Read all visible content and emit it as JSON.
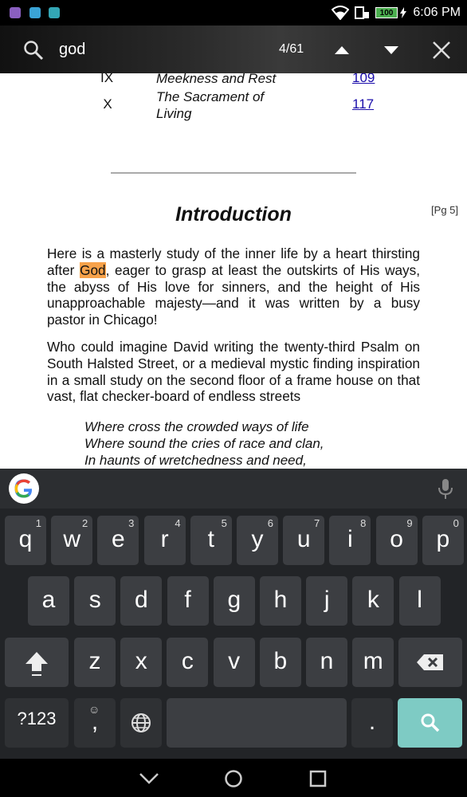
{
  "status_bar": {
    "time": "6:06 PM",
    "battery": "100",
    "app_icon_colors": [
      "#8a5fc0",
      "#3aa3d6",
      "#33a6b5"
    ]
  },
  "search_bar": {
    "query": "god",
    "match_count": "4/61"
  },
  "book": {
    "toc": [
      {
        "num": "IX",
        "title": "Meekness and Rest",
        "page": "109"
      },
      {
        "num": "X",
        "title_line1": "The Sacrament of",
        "title_line2": "Living",
        "page": "117"
      }
    ],
    "heading": "Introduction",
    "page_marker": "[Pg 5]",
    "para1": {
      "before": "Here is a masterly study of the inner life by a heart thirsting after ",
      "highlight": "God",
      "after": ", eager to grasp at least the outskirts of His ways, the abyss of His love for sinners, and the height of His unapproachable majesty—and it was written by a busy pastor in Chicago!"
    },
    "para2": "Who could imagine David writing the twenty-third Psalm on South Halsted Street, or a medieval mystic finding inspiration in a small study on the second floor of a frame house on that vast, flat checker-board of endless streets",
    "poem": [
      "Where cross the crowded ways of life",
      "Where sound the cries of race and clan,",
      "In haunts of wretchedness and need,"
    ]
  },
  "keyboard": {
    "row1": [
      {
        "key": "q",
        "hint": "1"
      },
      {
        "key": "w",
        "hint": "2"
      },
      {
        "key": "e",
        "hint": "3"
      },
      {
        "key": "r",
        "hint": "4"
      },
      {
        "key": "t",
        "hint": "5"
      },
      {
        "key": "y",
        "hint": "6"
      },
      {
        "key": "u",
        "hint": "7"
      },
      {
        "key": "i",
        "hint": "8"
      },
      {
        "key": "o",
        "hint": "9"
      },
      {
        "key": "p",
        "hint": "0"
      }
    ],
    "row2": [
      "a",
      "s",
      "d",
      "f",
      "g",
      "h",
      "j",
      "k",
      "l"
    ],
    "row3": [
      "z",
      "x",
      "c",
      "v",
      "b",
      "n",
      "m"
    ],
    "symbols_label": "?123",
    "comma": ",",
    "period": "."
  }
}
